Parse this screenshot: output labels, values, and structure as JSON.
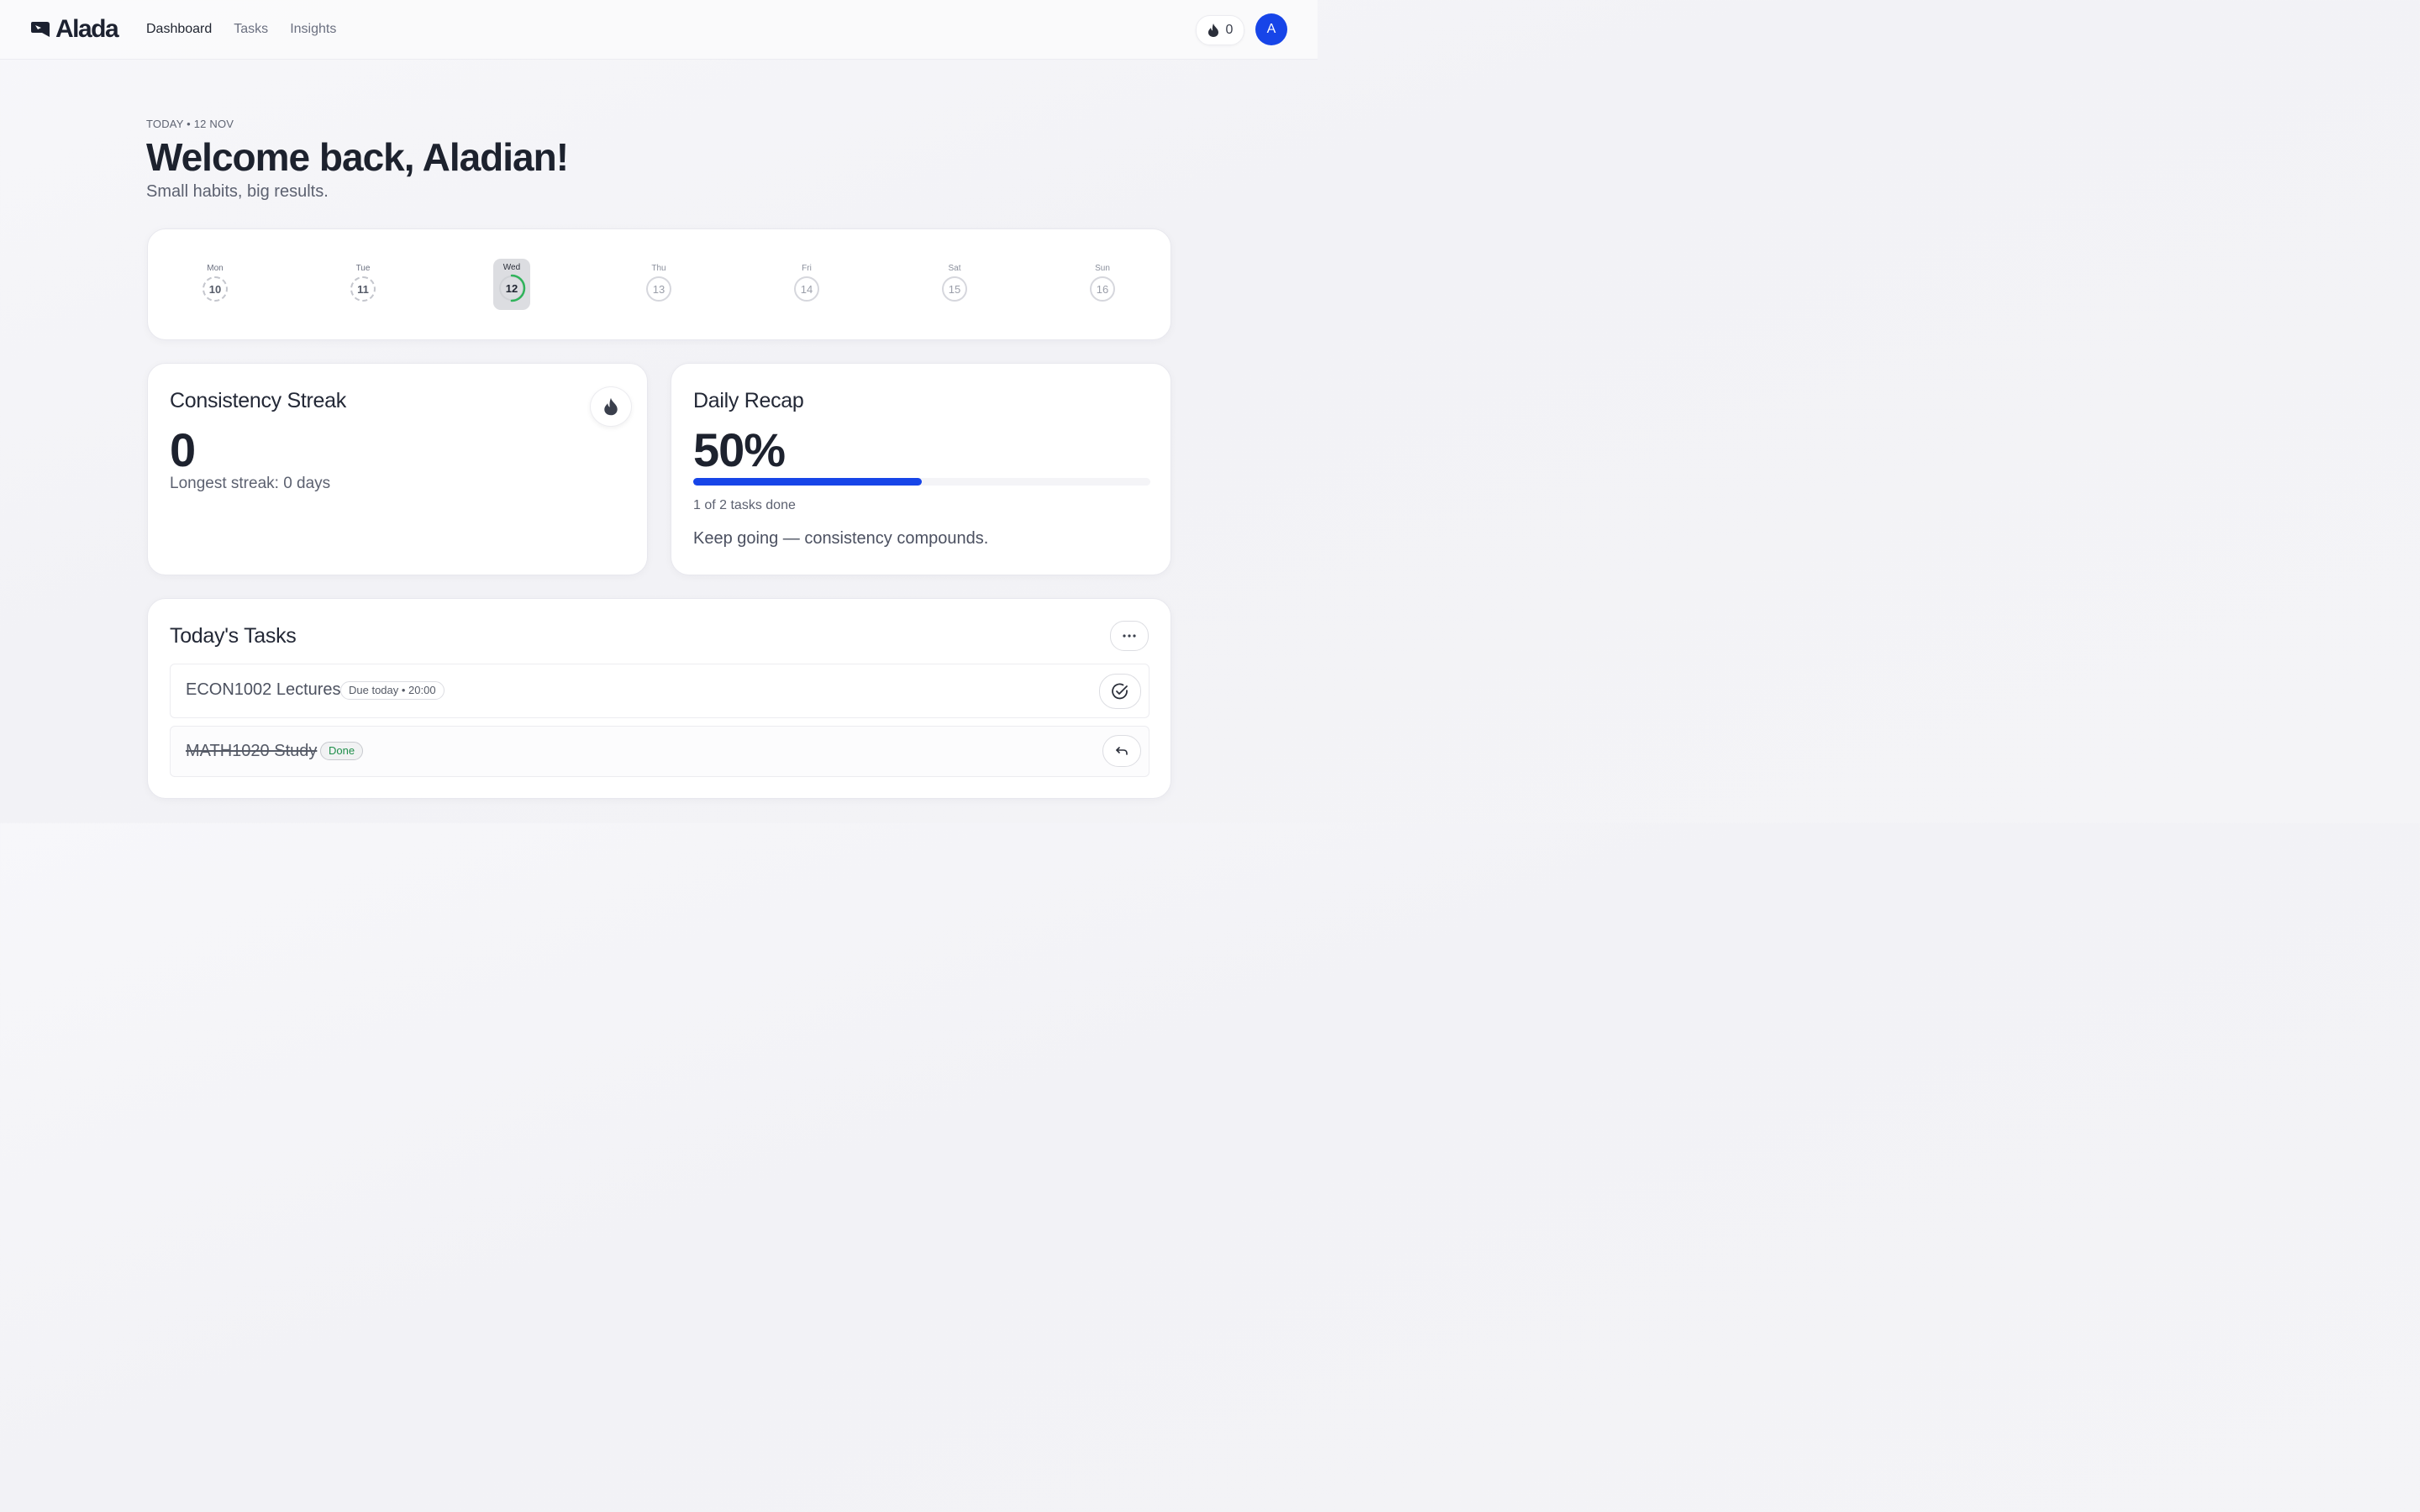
{
  "app": {
    "name": "Alada",
    "nav": [
      {
        "label": "Dashboard",
        "active": true
      },
      {
        "label": "Tasks",
        "active": false
      },
      {
        "label": "Insights",
        "active": false
      }
    ],
    "streak_count": "0",
    "avatar_initial": "A",
    "accent_color": "#1745e8"
  },
  "header": {
    "date_label": "TODAY • 12 NOV",
    "welcome": "Welcome back, Aladian!",
    "tagline": "Small habits, big results."
  },
  "week": [
    {
      "name": "Mon",
      "num": "10",
      "state": "past"
    },
    {
      "name": "Tue",
      "num": "11",
      "state": "past"
    },
    {
      "name": "Wed",
      "num": "12",
      "state": "today",
      "progress": 0.5
    },
    {
      "name": "Thu",
      "num": "13",
      "state": "future"
    },
    {
      "name": "Fri",
      "num": "14",
      "state": "future"
    },
    {
      "name": "Sat",
      "num": "15",
      "state": "future"
    },
    {
      "name": "Sun",
      "num": "16",
      "state": "future"
    }
  ],
  "streak": {
    "title": "Consistency Streak",
    "value": "0",
    "longest": "Longest streak: 0 days"
  },
  "recap": {
    "title": "Daily Recap",
    "percent_label": "50%",
    "progress": 0.5,
    "tasks_done": "1 of 2 tasks done",
    "message": "Keep going — consistency compounds."
  },
  "tasks": {
    "title": "Today's Tasks",
    "items": [
      {
        "name": "ECON1002 Lectures",
        "badge": "Due today • 20:00",
        "done": false,
        "action_icon": "check-circle-icon"
      },
      {
        "name": "MATH1020 Study",
        "badge": "Done",
        "done": true,
        "action_icon": "undo-icon"
      }
    ]
  }
}
